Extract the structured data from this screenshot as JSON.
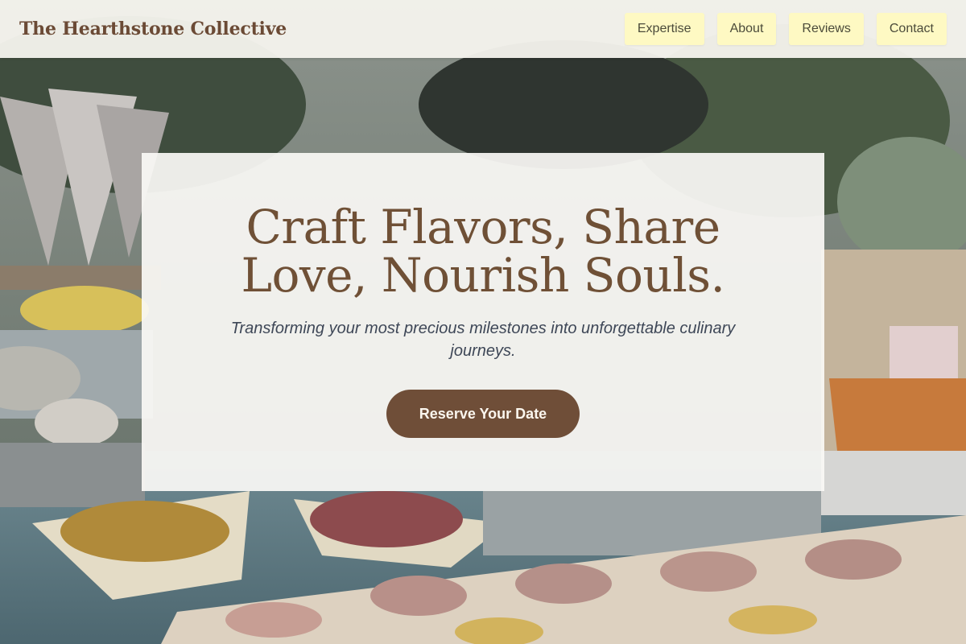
{
  "header": {
    "brand": "The Hearthstone Collective",
    "nav": [
      {
        "label": "Expertise"
      },
      {
        "label": "About"
      },
      {
        "label": "Reviews"
      },
      {
        "label": "Contact"
      }
    ]
  },
  "hero": {
    "title": "Craft Flavors, Share Love, Nourish Souls.",
    "subtitle": "Transforming your most precious milestones into unforgettable culinary journeys.",
    "cta_label": "Reserve Your Date"
  },
  "colors": {
    "brand_brown": "#6b4a35",
    "nav_button_bg": "#fef9c3",
    "cta_bg": "#6f4e38",
    "subtitle_text": "#3e4757"
  }
}
